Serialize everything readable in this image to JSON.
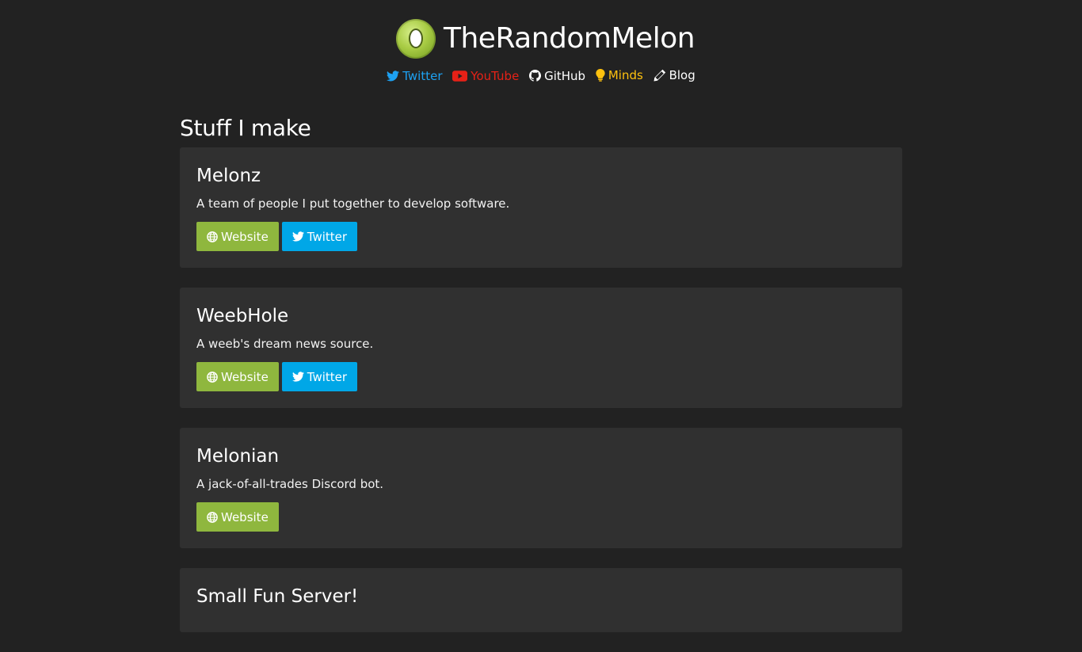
{
  "site": {
    "title": "TheRandomMelon"
  },
  "social": [
    {
      "label": "Twitter",
      "icon": "twitter-icon",
      "color": "#1da1f2"
    },
    {
      "label": "YouTube",
      "icon": "youtube-icon",
      "color": "#e62117"
    },
    {
      "label": "GitHub",
      "icon": "github-icon",
      "color": "#ffffff"
    },
    {
      "label": "Minds",
      "icon": "lightbulb-icon",
      "color": "#fec10e"
    },
    {
      "label": "Blog",
      "icon": "pencil-icon",
      "color": "#ffffff"
    }
  ],
  "section": {
    "title": "Stuff I make"
  },
  "projects": [
    {
      "name": "Melonz",
      "description": "A team of people I put together to develop software.",
      "buttons": {
        "website": "Website",
        "twitter": "Twitter"
      }
    },
    {
      "name": "WeebHole",
      "description": "A weeb's dream news source.",
      "buttons": {
        "website": "Website",
        "twitter": "Twitter"
      }
    },
    {
      "name": "Melonian",
      "description": "A jack-of-all-trades Discord bot.",
      "buttons": {
        "website": "Website"
      }
    },
    {
      "name": "Small Fun Server!"
    }
  ],
  "colors": {
    "background": "#222222",
    "card": "#303030",
    "website_button": "#8fb73e",
    "twitter_button": "#00a7e7"
  }
}
